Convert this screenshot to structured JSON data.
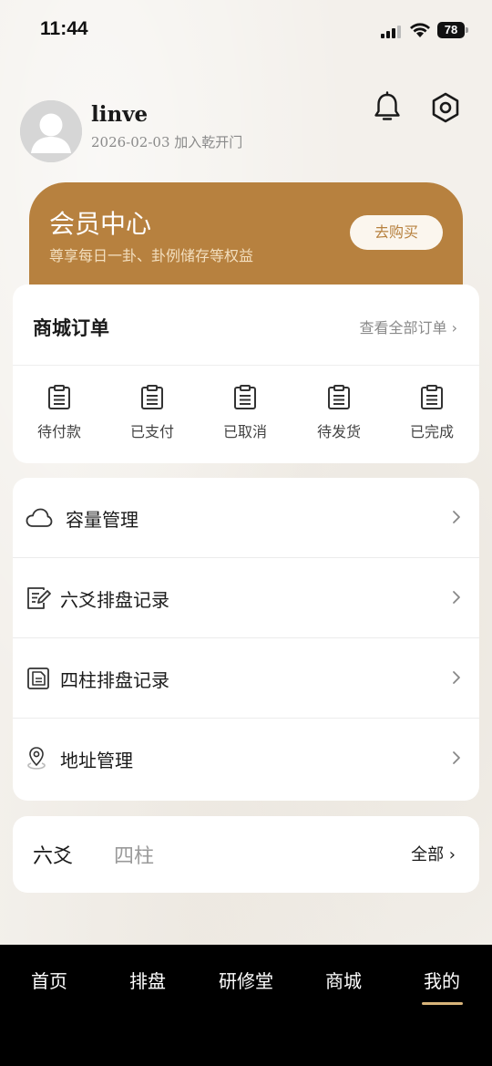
{
  "status_bar": {
    "time": "11:44",
    "battery": "78"
  },
  "profile": {
    "username": "linve",
    "joined": "2026-02-03 加入乾开门"
  },
  "member": {
    "title": "会员中心",
    "subtitle": "尊享每日一卦、卦例储存等权益",
    "buy_label": "去购买"
  },
  "orders": {
    "title": "商城订单",
    "view_all": "查看全部订单 ›",
    "items": [
      {
        "label": "待付款"
      },
      {
        "label": "已支付"
      },
      {
        "label": "已取消"
      },
      {
        "label": "待发货"
      },
      {
        "label": "已完成"
      }
    ]
  },
  "menu": {
    "items": [
      {
        "label": "容量管理",
        "icon": "cloud-icon"
      },
      {
        "label": "六爻排盘记录",
        "icon": "notepad-edit-icon"
      },
      {
        "label": "四柱排盘记录",
        "icon": "document-icon"
      },
      {
        "label": "地址管理",
        "icon": "location-pin-icon"
      }
    ]
  },
  "tabs": {
    "items": [
      "六爻",
      "四柱"
    ],
    "active_index": 0,
    "all_label": "全部 ›"
  },
  "bottom_nav": {
    "items": [
      "首页",
      "排盘",
      "研修堂",
      "商城",
      "我的"
    ],
    "active_index": 4
  },
  "colors": {
    "accent": "#b7813f",
    "nav_underline": "#d8b47a",
    "nav_bg": "#000000"
  }
}
